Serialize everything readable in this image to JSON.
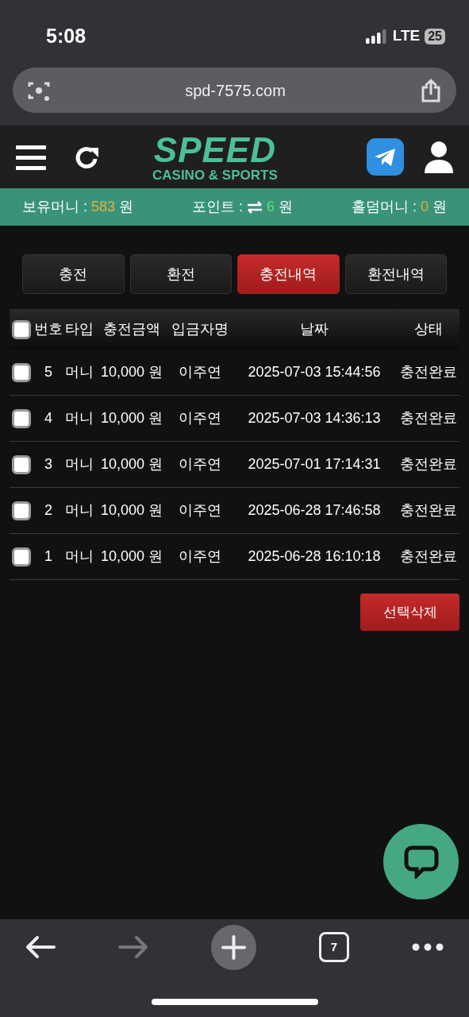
{
  "status_bar": {
    "time": "5:08",
    "network": "LTE",
    "battery": "25"
  },
  "browser": {
    "url": "spd-7575.com",
    "tab_count": "7",
    "forward_disabled": true
  },
  "header": {
    "logo_title": "SPEED",
    "logo_subtitle": "CASINO & SPORTS"
  },
  "balance_bar": [
    {
      "label": "보유머니 :",
      "value": "583",
      "unit": "원",
      "kind": "plain",
      "color": "#e0b040"
    },
    {
      "label": "포인트 :",
      "value": "6",
      "unit": "원",
      "kind": "exchange",
      "color": "#5be07a"
    },
    {
      "label": "홀덤머니 :",
      "value": "0",
      "unit": "원",
      "kind": "plain",
      "color": "#e0b040"
    }
  ],
  "tabs": [
    {
      "label": "충전",
      "selected": false
    },
    {
      "label": "환전",
      "selected": false
    },
    {
      "label": "충전내역",
      "selected": true
    },
    {
      "label": "환전내역",
      "selected": false
    }
  ],
  "table": {
    "select_all_checked": false,
    "columns": [
      "번호",
      "타입",
      "충전금액",
      "입금자명",
      "날짜",
      "상태"
    ],
    "rows": [
      {
        "checked": false,
        "cells": [
          "5",
          "머니",
          "10,000 원",
          "이주연",
          "2025-07-03 15:44:56",
          "충전완료"
        ]
      },
      {
        "checked": false,
        "cells": [
          "4",
          "머니",
          "10,000 원",
          "이주연",
          "2025-07-03 14:36:13",
          "충전완료"
        ]
      },
      {
        "checked": false,
        "cells": [
          "3",
          "머니",
          "10,000 원",
          "이주연",
          "2025-07-01 17:14:31",
          "충전완료"
        ]
      },
      {
        "checked": false,
        "cells": [
          "2",
          "머니",
          "10,000 원",
          "이주연",
          "2025-06-28 17:46:58",
          "충전완료"
        ]
      },
      {
        "checked": false,
        "cells": [
          "1",
          "머니",
          "10,000 원",
          "이주연",
          "2025-06-28 16:10:18",
          "충전완료"
        ]
      }
    ]
  },
  "delete_button": "선택삭제"
}
